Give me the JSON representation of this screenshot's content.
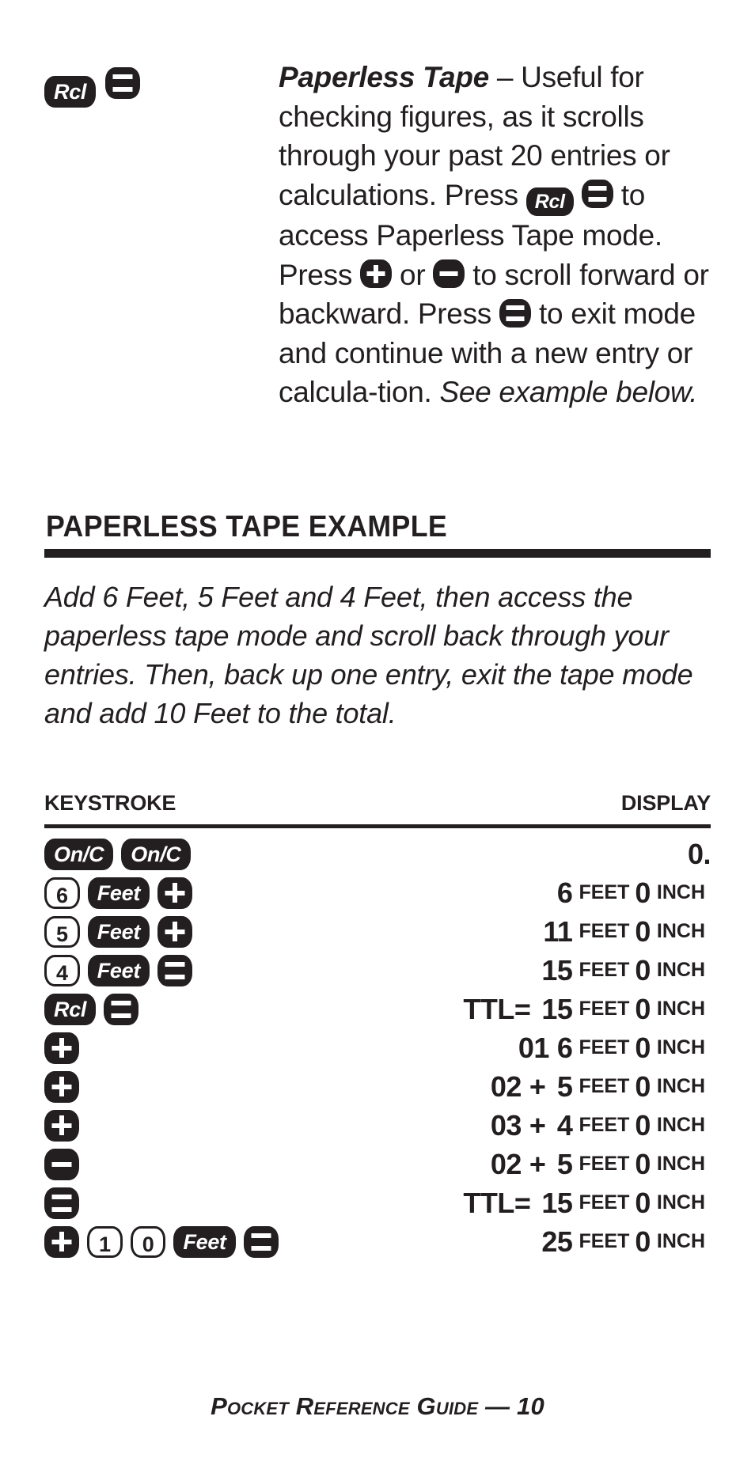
{
  "feature": {
    "keys": [
      {
        "icon": "rcl-key",
        "label": "Rcl",
        "type": "text"
      },
      {
        "icon": "equals-key",
        "label": "=",
        "type": "equals"
      }
    ],
    "title": "Paperless Tape",
    "dash": " – ",
    "body_1": "Useful for checking figures, as it scrolls through your past 20 entries or calculations. Press ",
    "inline_key_1": "Rcl",
    "inline_key_2": "=",
    "body_2": " to access Paperless Tape mode. Press ",
    "inline_key_3": "+",
    "body_3": " or ",
    "inline_key_4": "–",
    "body_4": " to scroll forward or backward. Press ",
    "inline_key_5": "=",
    "body_5": " to exit mode and continue with a new entry or calcula-tion. ",
    "body_italic": "See example below."
  },
  "section": {
    "heading": "PAPERLESS TAPE EXAMPLE",
    "intro": "Add 6 Feet, 5 Feet and 4 Feet, then access the paperless tape mode and scroll back through your entries. Then, back up one entry, exit the tape mode and add 10 Feet to the total."
  },
  "table": {
    "header_keystroke": "KEYSTROKE",
    "header_display": "DISPLAY",
    "rows": [
      {
        "keys": [
          {
            "icon": "onc-key",
            "label": "On/C",
            "type": "text"
          },
          {
            "icon": "onc-key",
            "label": "On/C",
            "type": "text"
          }
        ],
        "display": {
          "value": "0.",
          "feet": "",
          "feet_label": "",
          "inch": "",
          "inch_label": "",
          "prefix": "",
          "op": ""
        }
      },
      {
        "keys": [
          {
            "icon": "digit-6-key",
            "label": "6",
            "type": "digit"
          },
          {
            "icon": "feet-key",
            "label": "Feet",
            "type": "text"
          },
          {
            "icon": "plus-key",
            "label": "+",
            "type": "plus"
          }
        ],
        "display": {
          "prefix": "",
          "op": "",
          "value": "6",
          "feet_label": "FEET",
          "inch": "0",
          "inch_label": "INCH"
        }
      },
      {
        "keys": [
          {
            "icon": "digit-5-key",
            "label": "5",
            "type": "digit"
          },
          {
            "icon": "feet-key",
            "label": "Feet",
            "type": "text"
          },
          {
            "icon": "plus-key",
            "label": "+",
            "type": "plus"
          }
        ],
        "display": {
          "prefix": "",
          "op": "",
          "value": "11",
          "feet_label": "FEET",
          "inch": "0",
          "inch_label": "INCH"
        }
      },
      {
        "keys": [
          {
            "icon": "digit-4-key",
            "label": "4",
            "type": "digit"
          },
          {
            "icon": "feet-key",
            "label": "Feet",
            "type": "text"
          },
          {
            "icon": "equals-key",
            "label": "=",
            "type": "equals"
          }
        ],
        "display": {
          "prefix": "",
          "op": "",
          "value": "15",
          "feet_label": "FEET",
          "inch": "0",
          "inch_label": "INCH"
        }
      },
      {
        "keys": [
          {
            "icon": "rcl-key",
            "label": "Rcl",
            "type": "text"
          },
          {
            "icon": "equals-key",
            "label": "=",
            "type": "equals"
          }
        ],
        "display": {
          "prefix": "TTL=",
          "op": "",
          "value": "15",
          "feet_label": "FEET",
          "inch": "0",
          "inch_label": "INCH"
        }
      },
      {
        "keys": [
          {
            "icon": "plus-key",
            "label": "+",
            "type": "plus"
          }
        ],
        "display": {
          "prefix": "",
          "index": "01",
          "op": "",
          "value": "6",
          "feet_label": "FEET",
          "inch": "0",
          "inch_label": "INCH"
        }
      },
      {
        "keys": [
          {
            "icon": "plus-key",
            "label": "+",
            "type": "plus"
          }
        ],
        "display": {
          "prefix": "",
          "index": "02",
          "op": "+",
          "value": "5",
          "feet_label": "FEET",
          "inch": "0",
          "inch_label": "INCH"
        }
      },
      {
        "keys": [
          {
            "icon": "plus-key",
            "label": "+",
            "type": "plus"
          }
        ],
        "display": {
          "prefix": "",
          "index": "03",
          "op": "+",
          "value": "4",
          "feet_label": "FEET",
          "inch": "0",
          "inch_label": "INCH"
        }
      },
      {
        "keys": [
          {
            "icon": "minus-key",
            "label": "–",
            "type": "minus"
          }
        ],
        "display": {
          "prefix": "",
          "index": "02",
          "op": "+",
          "value": "5",
          "feet_label": "FEET",
          "inch": "0",
          "inch_label": "INCH"
        }
      },
      {
        "keys": [
          {
            "icon": "equals-key",
            "label": "=",
            "type": "equals"
          }
        ],
        "display": {
          "prefix": "TTL=",
          "op": "",
          "value": "15",
          "feet_label": "FEET",
          "inch": "0",
          "inch_label": "INCH"
        }
      },
      {
        "keys": [
          {
            "icon": "plus-key",
            "label": "+",
            "type": "plus"
          },
          {
            "icon": "digit-1-key",
            "label": "1",
            "type": "digit"
          },
          {
            "icon": "digit-0-key",
            "label": "0",
            "type": "digit"
          },
          {
            "icon": "feet-key",
            "label": "Feet",
            "type": "text"
          },
          {
            "icon": "equals-key",
            "label": "=",
            "type": "equals"
          }
        ],
        "display": {
          "prefix": "",
          "op": "",
          "value": "25",
          "feet_label": "FEET",
          "inch": "0",
          "inch_label": "INCH"
        }
      }
    ]
  },
  "footer": {
    "text": "Pocket Reference Guide — 10"
  },
  "colors": {
    "ink": "#231f20",
    "paper": "#ffffff"
  }
}
